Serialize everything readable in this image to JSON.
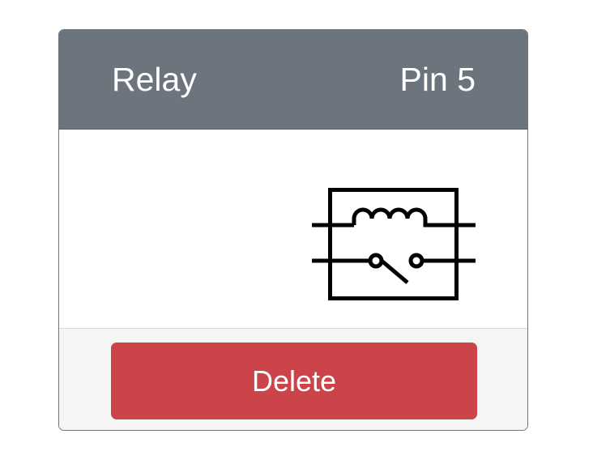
{
  "card": {
    "title": "Relay",
    "pin_label": "Pin 5",
    "body": {
      "icon": "relay-symbol-icon"
    },
    "footer": {
      "delete_label": "Delete"
    }
  },
  "colors": {
    "header_bg": "#6c757d",
    "delete_bg": "#cb444a",
    "footer_bg": "#f5f5f5"
  }
}
